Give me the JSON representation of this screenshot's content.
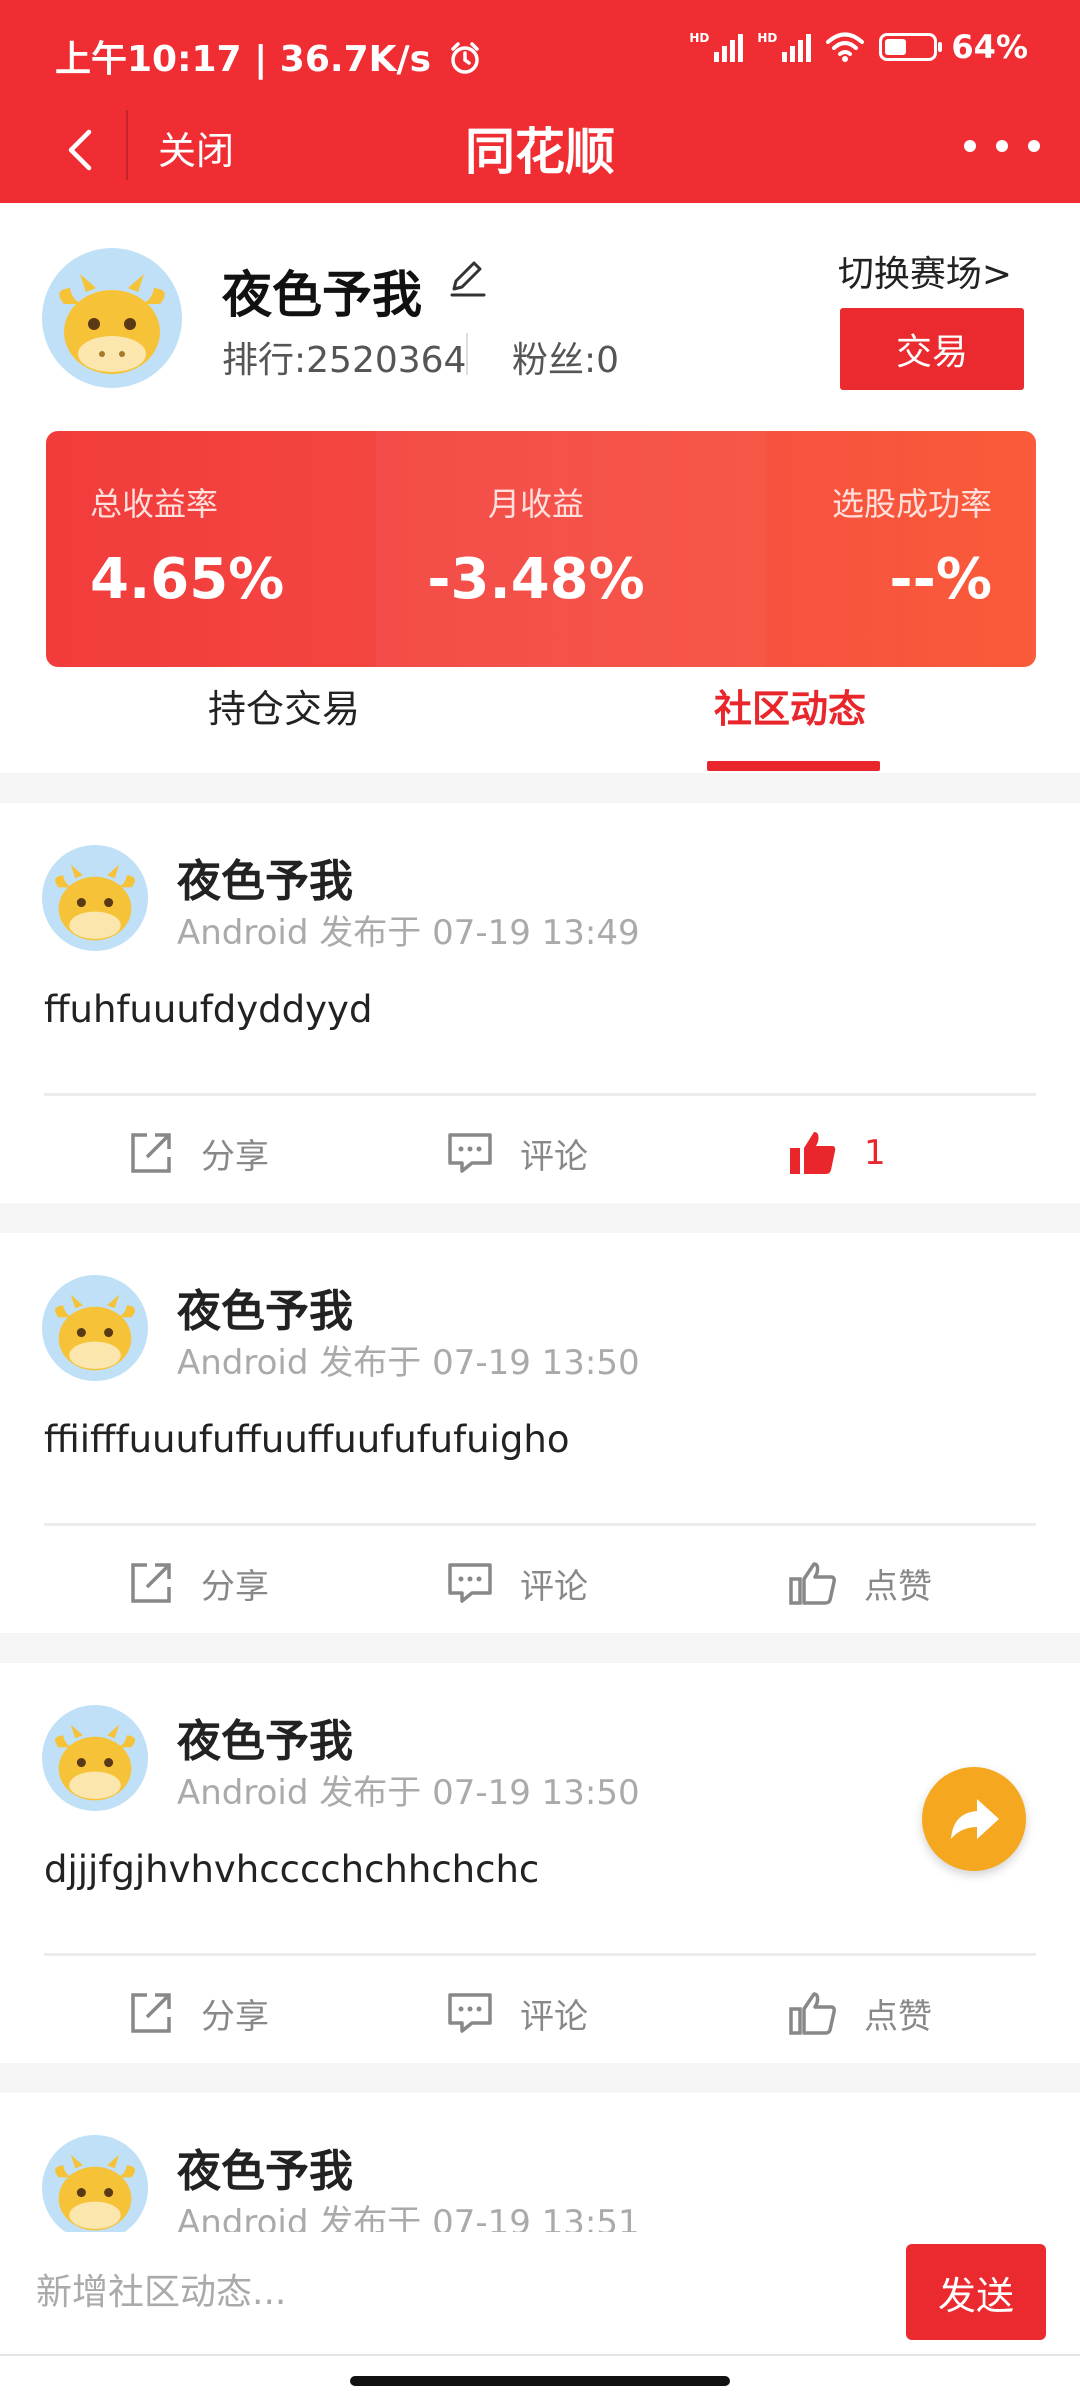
{
  "status_bar": {
    "time": "上午10:17 | 36.7K/s",
    "network_1": "HD",
    "network_2": "HD",
    "battery": "64%"
  },
  "nav": {
    "close_label": "关闭",
    "title": "同花顺"
  },
  "profile": {
    "name": "夜色予我",
    "rank": "排行:2520364",
    "fans": "粉丝:0",
    "switch_link": "切换赛场>",
    "trade_button": "交易"
  },
  "stats": [
    {
      "label": "总收益率",
      "value": "4.65%"
    },
    {
      "label": "月收益",
      "value": "-3.48%"
    },
    {
      "label": "选股成功率",
      "value": "--%"
    }
  ],
  "tabs": [
    {
      "label": "持仓交易"
    },
    {
      "label": "社区动态"
    }
  ],
  "actions": {
    "share": "分享",
    "comment": "评论",
    "like": "点赞"
  },
  "posts": [
    {
      "author": "夜色予我",
      "meta": "Android 发布于 07-19 13:49",
      "content": "ffuhfuuufdyddyyd",
      "like_text": "1",
      "liked": true
    },
    {
      "author": "夜色予我",
      "meta": "Android 发布于 07-19 13:50",
      "content": "ffiifffuuufuffuuffuufufufuigho",
      "like_text": "点赞",
      "liked": false
    },
    {
      "author": "夜色予我",
      "meta": "Android 发布于 07-19 13:50",
      "content": "djjjfgjhvhvhcccchchhchchc",
      "like_text": "点赞",
      "liked": false
    },
    {
      "author": "夜色予我",
      "meta": "Android 发布于 07-19 13:51"
    }
  ],
  "composer": {
    "placeholder": "新增社区动态...",
    "send_label": "发送"
  },
  "colors": {
    "brand_red": "#ef2d33",
    "fab_orange": "#f6a720"
  }
}
